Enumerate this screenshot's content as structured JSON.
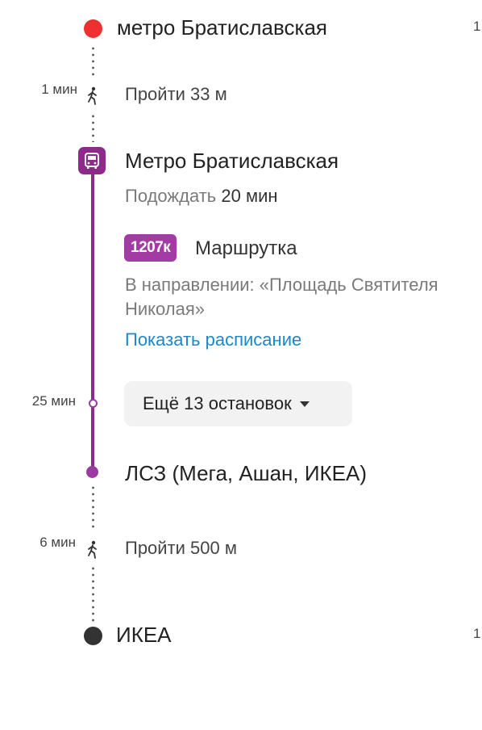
{
  "route": {
    "start": {
      "name": "метро Братиславская",
      "edge_number": "1",
      "marker_color": "#ef3030"
    },
    "walk_1": {
      "time": "1 мин",
      "text": "Пройти 33 м",
      "icon": "walking-person-icon"
    },
    "transit_stop": {
      "name": "Метро Братиславская",
      "wait_prefix": "Подождать",
      "wait_value": "20 мин",
      "icon": "bus-icon",
      "color": "#8e2b8a"
    },
    "transit": {
      "badge": "1207к",
      "type": "Маршрутка",
      "direction": "В направлении: «Площадь Святителя Николая»",
      "schedule_link": "Показать расписание"
    },
    "ride": {
      "time": "25 мин",
      "more_stops": "Ещё 13 остановок",
      "chevron": "chevron-down-icon"
    },
    "exit_stop": {
      "name": "ЛСЗ (Мега, Ашан, ИКЕА)"
    },
    "walk_2": {
      "time": "6 мин",
      "text": "Пройти 500 м",
      "icon": "walking-person-icon"
    },
    "end": {
      "name": "ИКЕА",
      "edge_number": "1",
      "marker_color": "#333333"
    }
  }
}
